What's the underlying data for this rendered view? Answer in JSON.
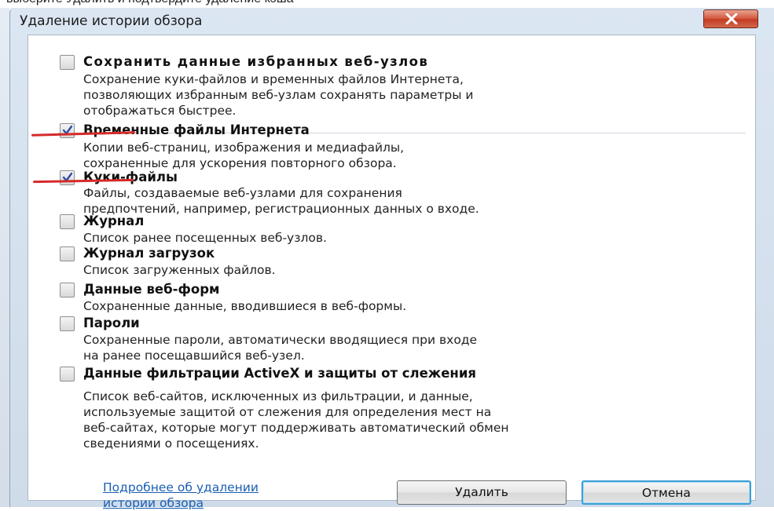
{
  "top_caption": "выберите Удалить и подтвердите удаление кэша",
  "dialog": {
    "title": "Удаление истории обзора",
    "close_icon": "close-icon"
  },
  "items": [
    {
      "title": "Сохранить данные избранных веб-узлов",
      "description": "Сохранение куки-файлов и временных файлов Интернета,\nпозволяющих избранным веб-узлам сохранять параметры и\nотображаться быстрее.",
      "checked": false
    },
    {
      "title": "Временные файлы Интернета",
      "description": "Копии веб-страниц, изображения и медиафайлы,\nсохраненные для ускорения повторного обзора.",
      "checked": true
    },
    {
      "title": "Куки-файлы",
      "description": "Файлы, создаваемые веб-узлами для сохранения\nпредпочтений, например, регистрационных данных о входе.",
      "checked": true
    },
    {
      "title": "Журнал",
      "description": "Список ранее посещенных веб-узлов.",
      "checked": false
    },
    {
      "title": "Журнал загрузок",
      "description": "Список загруженных файлов.",
      "checked": false
    },
    {
      "title": "Данные веб-форм",
      "description": "Сохраненные данные, вводившиеся в веб-формы.",
      "checked": false
    },
    {
      "title": "Пароли",
      "description": "Сохраненные пароли, автоматически вводящиеся при входе\nна ранее посещавшийся веб-узел.",
      "checked": false
    },
    {
      "title": "Данные фильтрации ActiveX и защиты от слежения",
      "description": "Список веб-сайтов, исключенных из фильтрации, и данные,\nиспользуемые защитой от слежения для определения мест на\nвеб-сайтах, которые могут поддерживать автоматический обмен\nсведениями о посещениях.",
      "checked": false
    }
  ],
  "footer": {
    "more_link": "Подробнее об удалении\nистории обзора",
    "delete_label": "Удалить",
    "cancel_label": "Отмена"
  },
  "colors": {
    "annotation_red": "#d62a2a",
    "link": "#1a5fb4",
    "close_red": "#c23b22"
  }
}
